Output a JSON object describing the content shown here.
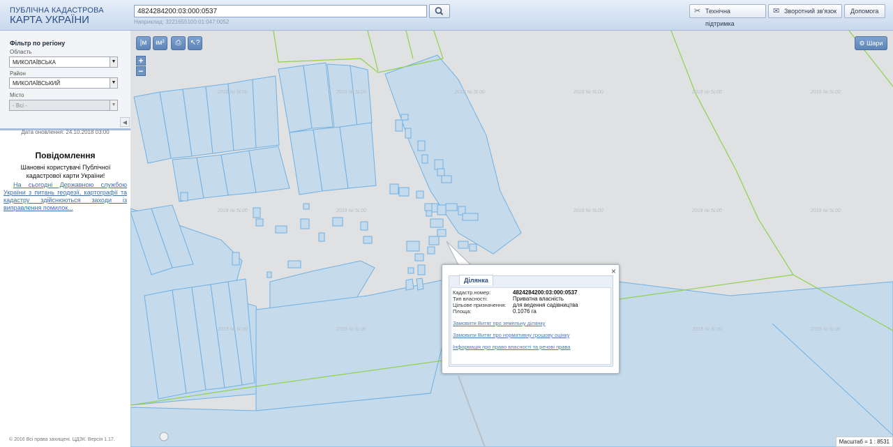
{
  "header": {
    "logo_line1": "ПУБЛІЧНА КАДАСТРОВА",
    "logo_line2": "КАРТА УКРАЇНИ",
    "search_value": "4824284200:03:000:0537",
    "search_hint": "Наприклад: 3221655100:01:047:0052",
    "buttons": [
      "Технічна підтримка",
      "Зворотний зв'язок",
      "Допомога"
    ]
  },
  "sidebar": {
    "filter_title": "Фільтр по регіону",
    "region_label": "Область",
    "region_value": "МИКОЛАЇВСЬКА",
    "district_label": "Район",
    "district_value": "МИКОЛАЇВСЬКИЙ",
    "city_label": "Місто",
    "city_value": "- Всі -",
    "update_date": "Дата оновлення: 24.10.2018 03:00",
    "notice_title": "Повідомлення",
    "notice_text": "Шановні користувачі Публічної кадастрової карти України!",
    "notice_link": "На сьогодні Державною службою України з питань геодезії, картографії та кадастру здійснюються заходи із виправлення помилок...",
    "copyright": "© 2016 Всі права захищені. ЦДЗК. Версія 1.17."
  },
  "map": {
    "tools": [
      "|м",
      "ᵻм²"
    ],
    "layers_label": "Шари",
    "scale": "Масштаб = 1 : 8531",
    "zoom_in": "+",
    "zoom_out": "−"
  },
  "popup": {
    "tab": "Ділянка",
    "rows": [
      {
        "label": "Кадастр.номер:",
        "value": "4824284200:03:000:0537"
      },
      {
        "label": "Тип власності:",
        "value": "Приватна власність"
      },
      {
        "label": "Цільове призначення:",
        "value": "для ведення садівництва"
      },
      {
        "label": "Площа:",
        "value": "0.1076 га"
      }
    ],
    "links": [
      "Замовити Витяг про земельну ділянку",
      "Замовити Витяг про нормативну грошову оцінку",
      "Інформація про право власності та речові права"
    ]
  },
  "colors": {
    "parcel_fill": "#c5daea",
    "parcel_stroke": "#6fb0e3",
    "boundary": "#8fd14a"
  }
}
